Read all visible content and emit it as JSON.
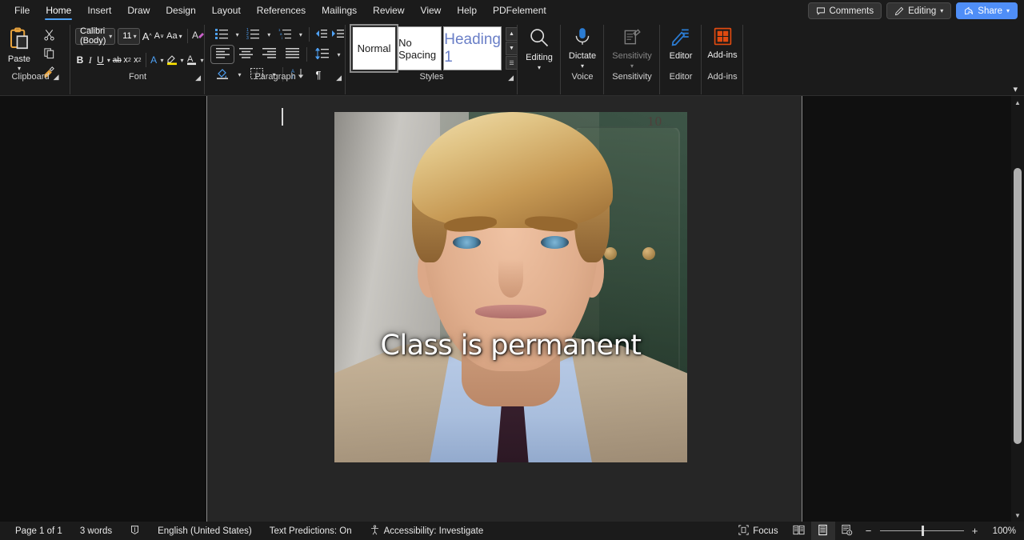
{
  "tabs": [
    {
      "label": "File",
      "active": false
    },
    {
      "label": "Home",
      "active": true
    },
    {
      "label": "Insert",
      "active": false
    },
    {
      "label": "Draw",
      "active": false
    },
    {
      "label": "Design",
      "active": false
    },
    {
      "label": "Layout",
      "active": false
    },
    {
      "label": "References",
      "active": false
    },
    {
      "label": "Mailings",
      "active": false
    },
    {
      "label": "Review",
      "active": false
    },
    {
      "label": "View",
      "active": false
    },
    {
      "label": "Help",
      "active": false
    },
    {
      "label": "PDFelement",
      "active": false
    }
  ],
  "titlebar_right": {
    "comments_label": "Comments",
    "editing_label": "Editing",
    "share_label": "Share",
    "share_color": "#4f8ef7"
  },
  "ribbon": {
    "groups": {
      "clipboard": {
        "label": "Clipboard",
        "paste_label": "Paste",
        "cut_name": "cut-icon",
        "copy_name": "copy-icon",
        "format_painter_name": "format-painter-icon"
      },
      "font": {
        "label": "Font",
        "font_name_value": "Calibri (Body)",
        "font_size_value": "11",
        "grow_font": "A",
        "shrink_font": "A",
        "change_case": "Aa",
        "clear_formatting": "A",
        "bold": "B",
        "italic": "I",
        "underline": "U",
        "strikethrough": "ab",
        "subscript": "x",
        "superscript": "x",
        "text_effects": "A",
        "highlight": "A",
        "font_color": "A"
      },
      "paragraph": {
        "label": "Paragraph"
      },
      "styles": {
        "label": "Styles",
        "items": [
          {
            "name": "Normal",
            "selected": true
          },
          {
            "name": "No Spacing",
            "selected": false
          },
          {
            "name": "Heading 1",
            "selected": false
          }
        ],
        "heading_color": "#6a7fc7"
      },
      "editing": {
        "label": "Editing",
        "button_label": "Editing"
      },
      "voice": {
        "label": "Voice",
        "button_label": "Dictate"
      },
      "sensitivity": {
        "label": "Sensitivity",
        "button_label": "Sensitivity",
        "disabled": true
      },
      "editor": {
        "label": "Editor",
        "button_label": "Editor"
      },
      "addins": {
        "label": "Add-ins",
        "button_label": "Add-ins",
        "accent": "#e04a10"
      }
    }
  },
  "document": {
    "image": {
      "alt": "Portrait of a smiling blond man in a tan pinstripe suit, blue shirt and dark tie, standing in front of a pale wall and a green cabinet",
      "caption_text": "Class is permanent",
      "caption_color": "#ffffff"
    }
  },
  "status": {
    "page": "Page 1 of 1",
    "words": "3 words",
    "proofing_icon": "proofing-icon",
    "language": "English (United States)",
    "text_predictions": "Text Predictions: On",
    "accessibility": "Accessibility: Investigate",
    "focus": "Focus",
    "zoom_out": "−",
    "zoom_in": "+",
    "zoom_value": "100%"
  }
}
